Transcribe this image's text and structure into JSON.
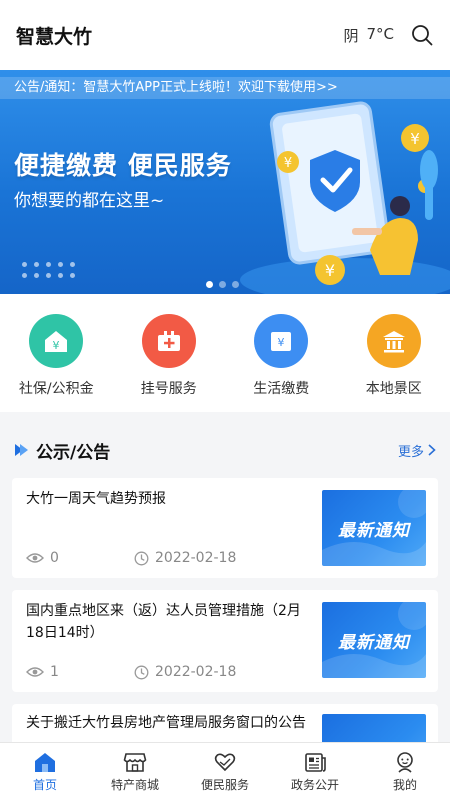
{
  "header": {
    "title": "智慧大竹",
    "weather_condition": "阴",
    "temperature": "7°C"
  },
  "banner": {
    "notice": "公告/通知：智慧大竹APP正式上线啦！欢迎下载使用>>",
    "headline": "便捷缴费  便民服务",
    "subtitle": "你想要的都在这里~",
    "pages": 3,
    "active_page": 1
  },
  "services": [
    {
      "label": "社保/公积金",
      "icon": "house-yen-icon",
      "color": "#2fc4a6"
    },
    {
      "label": "挂号服务",
      "icon": "medical-case-icon",
      "color": "#f25a45"
    },
    {
      "label": "生活缴费",
      "icon": "wallet-yen-icon",
      "color": "#3d8ef2"
    },
    {
      "label": "本地景区",
      "icon": "landmark-icon",
      "color": "#f5a623"
    }
  ],
  "news_section": {
    "title": "公示/公告",
    "more": "更多"
  },
  "news": [
    {
      "title": "大竹一周天气趋势预报",
      "views": "0",
      "date": "2022-02-18",
      "thumb_text": "最新通知"
    },
    {
      "title": "国内重点地区来（返）达人员管理措施（2月18日14时）",
      "views": "1",
      "date": "2022-02-18",
      "thumb_text": "最新通知"
    },
    {
      "title": "关于搬迁大竹县房地产管理局服务窗口的公告",
      "views": "",
      "date": "",
      "thumb_text": ""
    }
  ],
  "bottom_nav": [
    {
      "label": "首页",
      "icon": "home-icon",
      "active": true
    },
    {
      "label": "特产商城",
      "icon": "shop-icon",
      "active": false
    },
    {
      "label": "便民服务",
      "icon": "heart-hands-icon",
      "active": false
    },
    {
      "label": "政务公开",
      "icon": "newspaper-icon",
      "active": false
    },
    {
      "label": "我的",
      "icon": "user-icon",
      "active": false
    }
  ],
  "colors": {
    "accent": "#1f6fe0",
    "banner": "#1a74d6"
  }
}
